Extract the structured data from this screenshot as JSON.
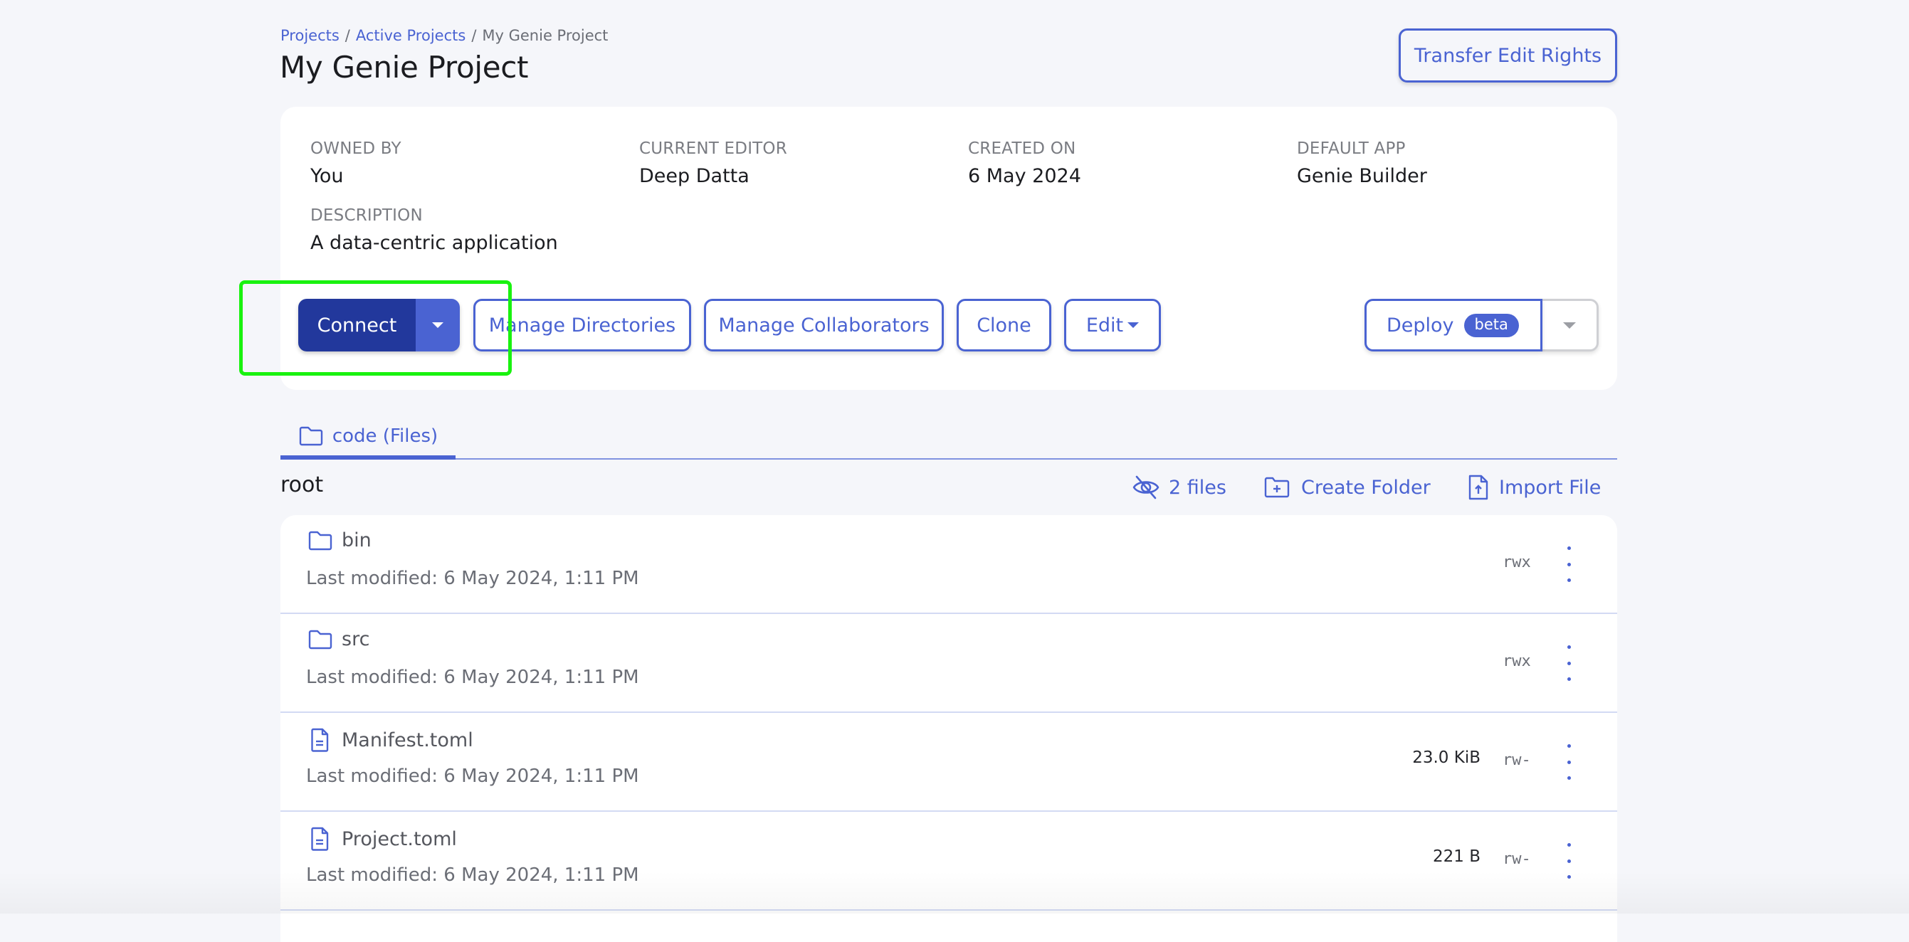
{
  "breadcrumb": {
    "items": [
      "Projects",
      "Active Projects"
    ],
    "current": "My Genie Project",
    "separator": "/"
  },
  "page": {
    "title": "My Genie Project",
    "transfer_button": "Transfer Edit Rights"
  },
  "info": {
    "owned_by_label": "OWNED BY",
    "owned_by_value": "You",
    "current_editor_label": "CURRENT EDITOR",
    "current_editor_value": "Deep Datta",
    "created_on_label": "CREATED ON",
    "created_on_value": "6 May 2024",
    "default_app_label": "DEFAULT APP",
    "default_app_value": "Genie Builder",
    "description_label": "DESCRIPTION",
    "description_value": "A data-centric application"
  },
  "actions": {
    "connect": "Connect",
    "manage_directories": "Manage Directories",
    "manage_collaborators": "Manage Collaborators",
    "clone": "Clone",
    "edit": "Edit",
    "deploy": "Deploy",
    "deploy_badge": "beta"
  },
  "tabs": [
    {
      "label": "code (Files)",
      "icon": "folder-icon",
      "active": true
    }
  ],
  "files_toolbar": {
    "path": "root",
    "hidden_files": "2 files",
    "create_folder": "Create Folder",
    "import_file": "Import File"
  },
  "files": [
    {
      "name": "bin",
      "type": "folder",
      "modified": "Last modified: 6 May 2024, 1:11 PM",
      "size": "",
      "permissions": "rwx"
    },
    {
      "name": "src",
      "type": "folder",
      "modified": "Last modified: 6 May 2024, 1:11 PM",
      "size": "",
      "permissions": "rwx"
    },
    {
      "name": "Manifest.toml",
      "type": "file",
      "modified": "Last modified: 6 May 2024, 1:11 PM",
      "size": "23.0 KiB",
      "permissions": "rw-"
    },
    {
      "name": "Project.toml",
      "type": "file",
      "modified": "Last modified: 6 May 2024, 1:11 PM",
      "size": "221 B",
      "permissions": "rw-"
    }
  ],
  "colors": {
    "accent": "#4a63d2",
    "primary_dark": "#22389c",
    "background": "#f5f6fa",
    "highlight_annotation": "#19f20f"
  }
}
